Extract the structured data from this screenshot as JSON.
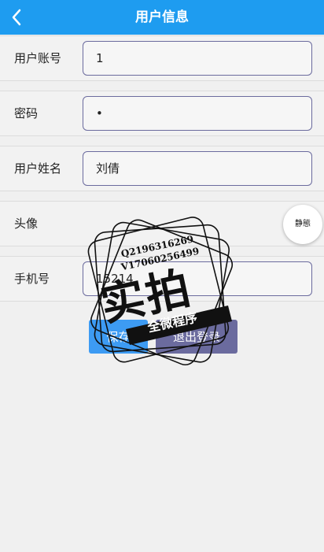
{
  "header": {
    "title": "用户信息",
    "back_icon": "chevron-left-icon"
  },
  "form": {
    "account": {
      "label": "用户账号",
      "value": "1"
    },
    "password": {
      "label": "密码",
      "value": "•"
    },
    "name": {
      "label": "用户姓名",
      "value": "刘倩"
    },
    "avatar": {
      "label": "头像",
      "image_text": "静態"
    },
    "phone": {
      "label": "手机号",
      "value": "15214"
    }
  },
  "actions": {
    "save_label": "保存",
    "logout_label": "退出登录"
  },
  "watermark": {
    "line1": "Q2196316269",
    "line2": "V17060256499",
    "main": "实拍",
    "ribbon": "全微程序"
  },
  "colors": {
    "header": "#1e9cf0",
    "save": "#3d9bf3",
    "logout": "#6b6b9e",
    "border": "#6b6b9e"
  }
}
